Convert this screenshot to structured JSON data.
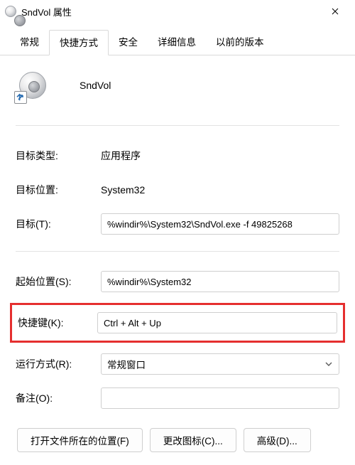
{
  "titlebar": {
    "title": "SndVol 属性"
  },
  "tabs": {
    "general": "常规",
    "shortcut": "快捷方式",
    "security": "安全",
    "details": "详细信息",
    "previous": "以前的版本"
  },
  "header": {
    "name_value": "SndVol"
  },
  "fields": {
    "target_type_label": "目标类型:",
    "target_type_value": "应用程序",
    "target_location_label": "目标位置:",
    "target_location_value": "System32",
    "target_label": "目标(T):",
    "target_value": "%windir%\\System32\\SndVol.exe -f 49825268",
    "start_in_label": "起始位置(S):",
    "start_in_value": "%windir%\\System32",
    "hotkey_label": "快捷键(K):",
    "hotkey_value": "Ctrl + Alt + Up",
    "run_label": "运行方式(R):",
    "run_value": "常规窗口",
    "comment_label": "备注(O):",
    "comment_value": ""
  },
  "buttons": {
    "open_location": "打开文件所在的位置(F)",
    "change_icon": "更改图标(C)...",
    "advanced": "高级(D)..."
  }
}
